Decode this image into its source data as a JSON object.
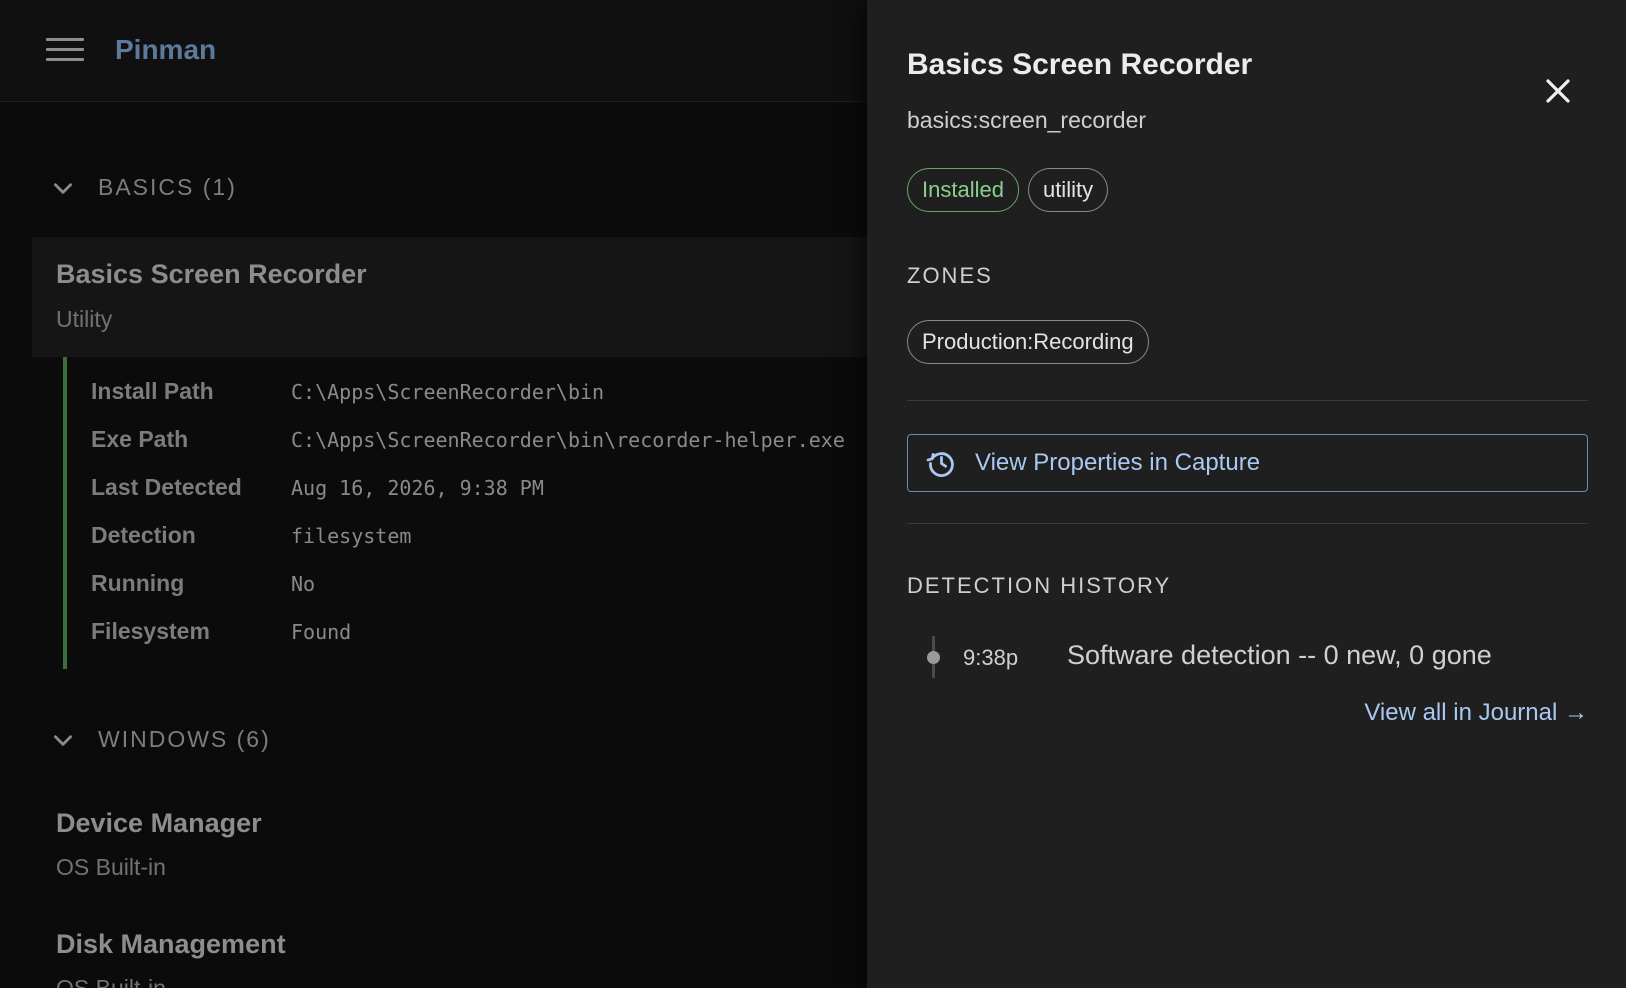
{
  "app": {
    "brand": "Pinman"
  },
  "sections": {
    "basics": {
      "title": "BASICS (1)"
    },
    "windows": {
      "title": "WINDOWS (6)"
    }
  },
  "selected_item": {
    "title": "Basics Screen Recorder",
    "category": "Utility",
    "details": [
      {
        "label": "Install Path",
        "value": "C:\\Apps\\ScreenRecorder\\bin"
      },
      {
        "label": "Exe Path",
        "value": "C:\\Apps\\ScreenRecorder\\bin\\recorder-helper.exe"
      },
      {
        "label": "Last Detected",
        "value": "Aug 16, 2026, 9:38 PM"
      },
      {
        "label": "Detection",
        "value": "filesystem"
      },
      {
        "label": "Running",
        "value": "No"
      },
      {
        "label": "Filesystem",
        "value": "Found"
      }
    ]
  },
  "windows_items": [
    {
      "title": "Device Manager",
      "category": "OS Built-in"
    },
    {
      "title": "Disk Management",
      "category": "OS Built-in"
    }
  ],
  "panel": {
    "title": "Basics Screen Recorder",
    "identifier": "basics:screen_recorder",
    "tags": [
      "Installed",
      "utility"
    ],
    "zones_heading": "ZONES",
    "zones": [
      "Production:Recording"
    ],
    "capture_button": "View Properties in Capture",
    "history_heading": "DETECTION HISTORY",
    "history": [
      {
        "time": "9:38p",
        "text": "Software detection -- 0 new, 0 gone"
      }
    ],
    "journal_link": "View all in Journal →"
  },
  "icons": {
    "menu": "hamburger-icon",
    "section_toggle": "chevron-down-icon",
    "close": "close-icon",
    "capture": "history-icon"
  },
  "colors": {
    "accent_link": "#a9c8f2",
    "installed_green": "#8ccf8c",
    "detail_border": "#3c6e3c",
    "brand": "#5d7a9c"
  }
}
